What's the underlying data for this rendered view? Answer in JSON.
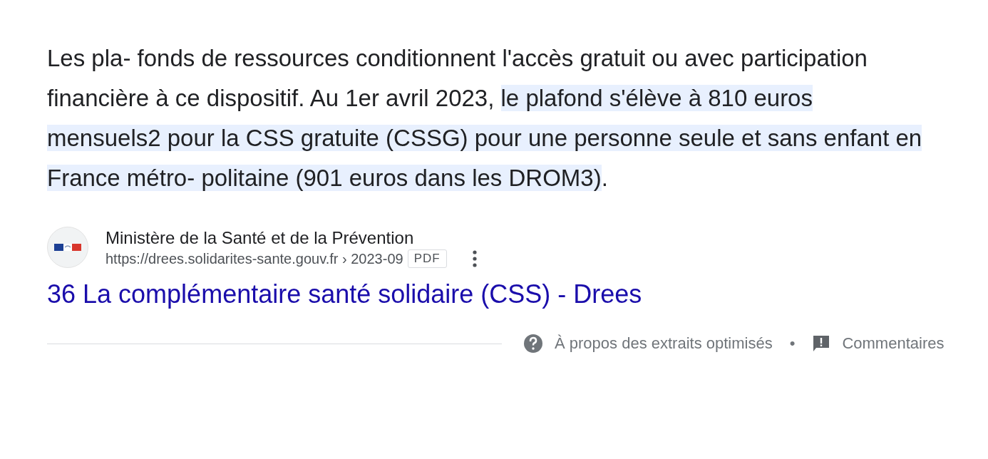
{
  "snippet": {
    "text": "Les pla- fonds de ressources conditionnent l'accès gratuit ou avec participation financière à ce dispositif. Au 1er avril 2023, ",
    "highlight": "le plafond s'élève à 810 euros mensuels2 pour la CSS gratuite (CSSG) pour une personne seule et sans enfant en France métro- politaine (901 euros dans les DROM3)",
    "tail": "."
  },
  "source": {
    "site": "Ministère de la Santé et de la Prévention",
    "url": "https://drees.solidarites-sante.gouv.fr › 2023-09",
    "filetype": "PDF",
    "title": "36 La complémentaire santé solidaire (CSS) - Drees"
  },
  "footer": {
    "about": "À propos des extraits optimisés",
    "separator": "•",
    "feedback": "Commentaires"
  }
}
